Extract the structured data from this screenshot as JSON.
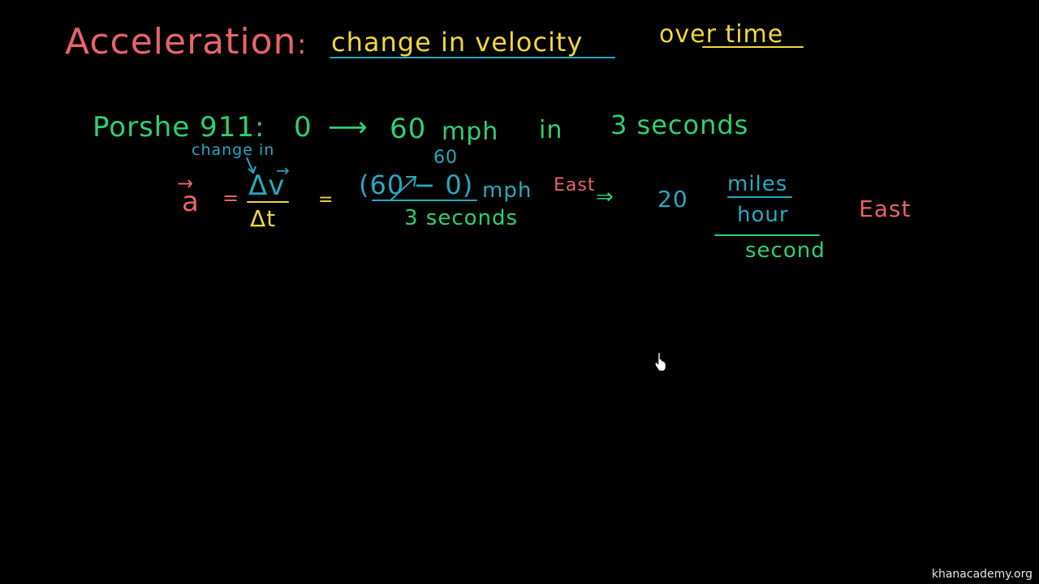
{
  "board": {
    "title": {
      "term": "Acceleration",
      "colon": ":",
      "definition_part1": "change in velocity",
      "definition_part2": "over time"
    },
    "example": {
      "label": "Porshe 911:",
      "from": "0",
      "arrow": "⟶",
      "to": "60",
      "unit": "mph",
      "in": "in",
      "duration": "3 seconds"
    },
    "equation": {
      "annotation": "change in",
      "acc_symbol": "a",
      "vec_arrow": "→",
      "equals1": "=",
      "numerator": "Δv",
      "denominator": "Δt",
      "equals2": "=",
      "correction": "60",
      "paren_expr": "(60 − 0)",
      "unit": "mph",
      "direction": "East",
      "den_value": "3 seconds",
      "implies": "⇒",
      "result": "20",
      "unit_num": "miles",
      "unit_mid": "hour",
      "unit_den": "second",
      "result_direction": "East"
    },
    "colors": {
      "red": "#e8636b",
      "yellow": "#f0d93a",
      "green": "#2fd072",
      "blue": "#28a9bd",
      "background": "#000000"
    }
  },
  "watermark": "khanacademy.org",
  "cursor": "hand-pointer"
}
